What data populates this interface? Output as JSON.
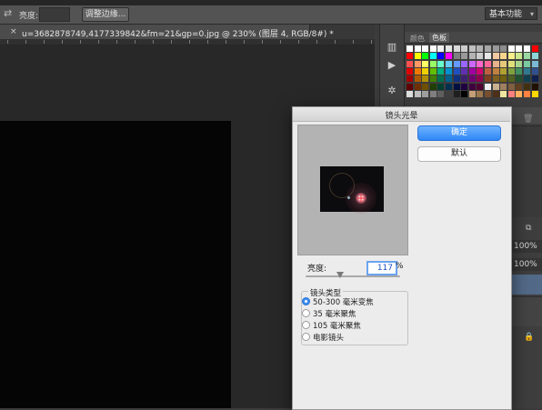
{
  "options_bar": {
    "brightness_label": "亮度:",
    "adjust_edge_button": "调整边缘...",
    "workspace": "基本功能"
  },
  "document": {
    "tab_title": "u=3682878749,4177339842&fm=21&gp=0.jpg @ 230% (图层 4, RGB/8#) *"
  },
  "panels": {
    "tabs": [
      "颜色",
      "色板"
    ],
    "active_tab": "色板",
    "opacity_1": "100%",
    "opacity_2": "100%",
    "swatch_rows": [
      [
        "#ffffff",
        "#ffffff",
        "#ffffff",
        "#ffffff",
        "#f2f2f2",
        "#e5e5e5",
        "#d9d9d9",
        "#cccccc",
        "#bfbfbf",
        "#b3b3b3",
        "#a6a6a6",
        "#999999",
        "#8c8c8c",
        "#ffffff",
        "#ffffff",
        "#ffffff",
        "#ff0000"
      ],
      [
        "#ff0000",
        "#ffff00",
        "#00ff00",
        "#00ffff",
        "#0000ff",
        "#ff00ff",
        "#808080",
        "#999999",
        "#b3b3b3",
        "#cccccc",
        "#e6e6e6",
        "#f2c8a0",
        "#f5d58c",
        "#f6f08a",
        "#cde88c",
        "#9ad6a0",
        "#8ed4d4"
      ],
      [
        "#ff5050",
        "#ff9966",
        "#ffff66",
        "#99ff66",
        "#66ffcc",
        "#66ccff",
        "#6699ff",
        "#9966ff",
        "#cc66ff",
        "#ff66cc",
        "#ff6699",
        "#e6b38c",
        "#e6c87a",
        "#e0e07a",
        "#a8d48c",
        "#7ac8a0",
        "#7ab8d4"
      ],
      [
        "#e00000",
        "#f07a00",
        "#f0d000",
        "#60c000",
        "#00b080",
        "#0090d0",
        "#2050c0",
        "#6030b0",
        "#a000a0",
        "#d00070",
        "#c06040",
        "#c08040",
        "#b0a030",
        "#80a040",
        "#409060",
        "#307890",
        "#305090"
      ],
      [
        "#a00000",
        "#b05a00",
        "#b09000",
        "#408000",
        "#007050",
        "#006090",
        "#103080",
        "#402070",
        "#700070",
        "#900050",
        "#804020",
        "#806020",
        "#706010",
        "#506020",
        "#205030",
        "#104050",
        "#102050"
      ],
      [
        "#600000",
        "#703000",
        "#705000",
        "#204000",
        "#004030",
        "#003050",
        "#001040",
        "#200040",
        "#400040",
        "#500030",
        "#f0f0f0",
        "#c8b090",
        "#a08060",
        "#806040",
        "#604020",
        "#403010",
        "#201000"
      ],
      [
        "#e0e0e0",
        "#c0c0c0",
        "#a0a0a0",
        "#808080",
        "#606060",
        "#404040",
        "#202020",
        "#000000",
        "#c8a078",
        "#a07850",
        "#785030",
        "#503018",
        "#f0e8a0",
        "#ff8080",
        "#ffb060",
        "#ff8040",
        "#ffd700"
      ]
    ]
  },
  "dialog": {
    "title": "镜头光晕",
    "ok_button": "确定",
    "default_button": "默认",
    "brightness_label": "亮度:",
    "brightness_value": "117",
    "brightness_unit": "%",
    "brightness_level": 117,
    "lens_type_label": "镜头类型",
    "lens_options": [
      {
        "label": "50-300 毫米变焦",
        "selected": true
      },
      {
        "label": "35 毫米聚焦",
        "selected": false
      },
      {
        "label": "105 毫米聚焦",
        "selected": false
      },
      {
        "label": "电影镜头",
        "selected": false
      }
    ]
  }
}
